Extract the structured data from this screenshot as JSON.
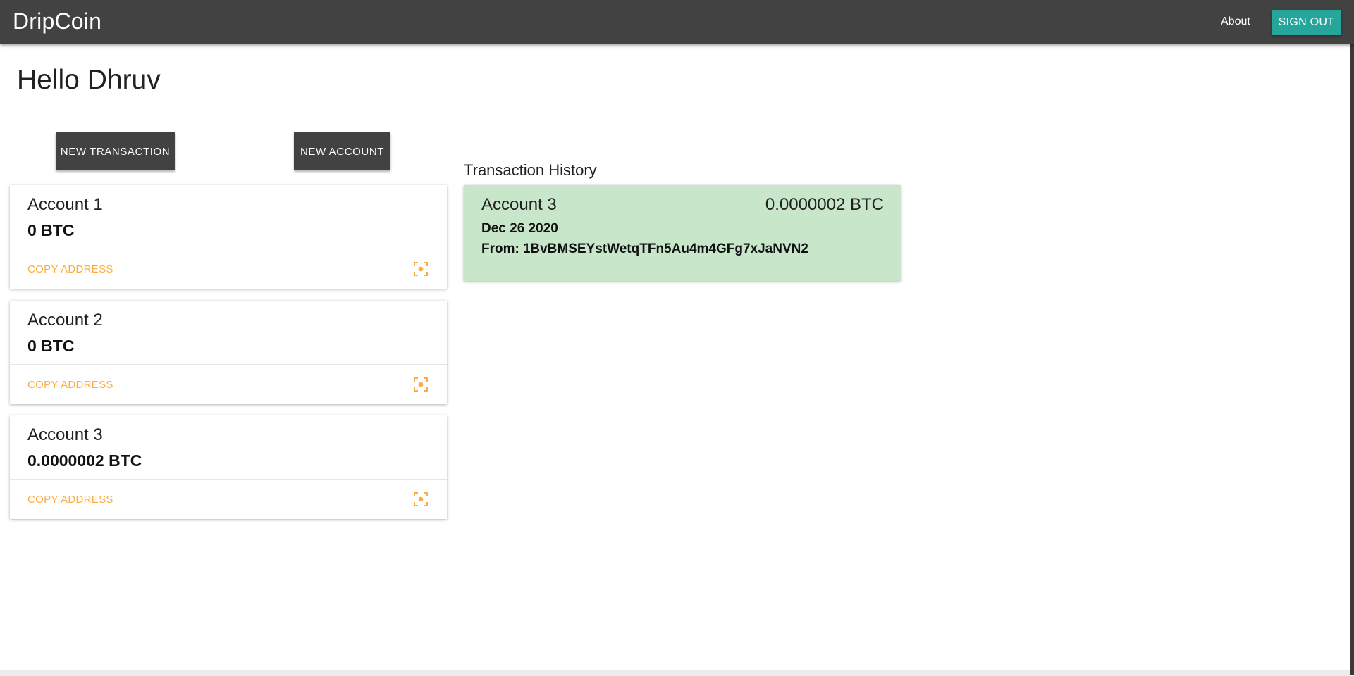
{
  "appbar": {
    "brand": "DripCoin",
    "about_label": "About",
    "signout_label": "SIGN OUT"
  },
  "main": {
    "greeting": "Hello Dhruv",
    "new_transaction_label": "NEW TRANSACTION",
    "new_account_label": "NEW ACCOUNT"
  },
  "accounts": [
    {
      "name": "Account 1",
      "balance": "0 BTC",
      "copy_label": "COPY ADDRESS",
      "icon": "qr-scan-icon"
    },
    {
      "name": "Account 2",
      "balance": "0 BTC",
      "copy_label": "COPY ADDRESS",
      "icon": "qr-scan-icon"
    },
    {
      "name": "Account 3",
      "balance": "0.0000002 BTC",
      "copy_label": "COPY ADDRESS",
      "icon": "qr-scan-icon"
    }
  ],
  "history": {
    "title": "Transaction History",
    "transactions": [
      {
        "account": "Account 3",
        "amount": "0.0000002 BTC",
        "date": "Dec 26 2020",
        "from_label": "From:",
        "from_address": "1BvBMSEYstWetqTFn5Au4m4GFg7xJaNVN2"
      }
    ]
  },
  "colors": {
    "appbar": "#424242",
    "signout": "#26a69a",
    "copy_link": "#ffab40",
    "tx_card": "#c8e6c9"
  }
}
